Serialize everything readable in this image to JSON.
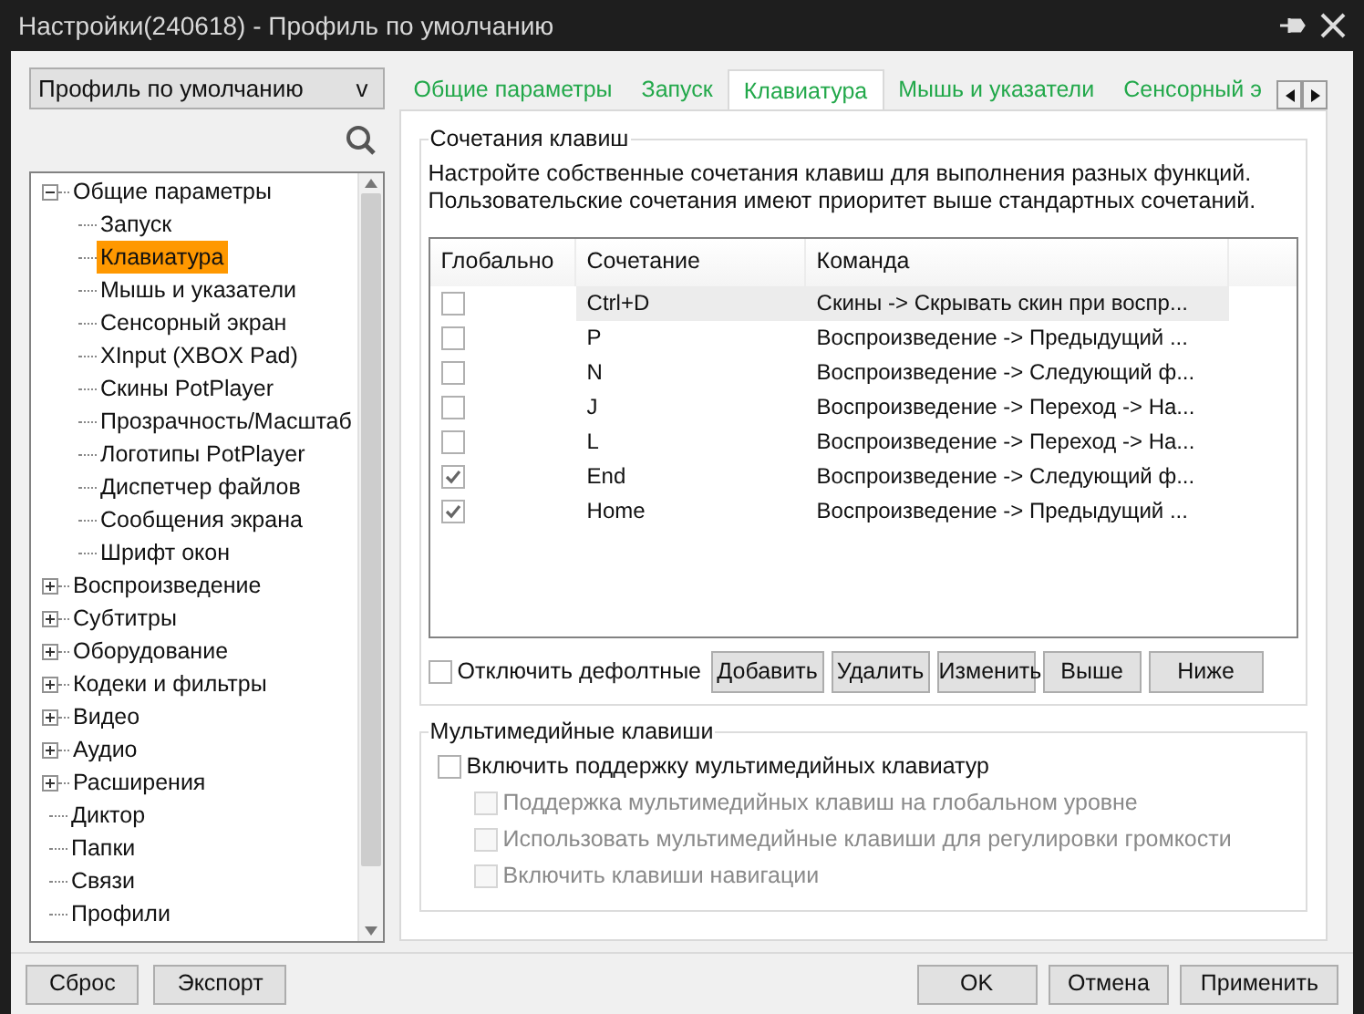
{
  "window": {
    "title": "Настройки(240618) - Профиль по умолчанию"
  },
  "profile": {
    "value": "Профиль по умолчанию",
    "arrow": "v"
  },
  "tree": [
    {
      "label": "Общие параметры",
      "expanded": true,
      "selected": false,
      "children": [
        {
          "label": "Запуск",
          "selected": false
        },
        {
          "label": "Клавиатура",
          "selected": true
        },
        {
          "label": "Мышь и указатели",
          "selected": false
        },
        {
          "label": "Сенсорный экран",
          "selected": false
        },
        {
          "label": "XInput (XBOX Pad)",
          "selected": false
        },
        {
          "label": "Скины PotPlayer",
          "selected": false
        },
        {
          "label": "Прозрачность/Масштаб",
          "selected": false
        },
        {
          "label": "Логотипы PotPlayer",
          "selected": false
        },
        {
          "label": "Диспетчер файлов",
          "selected": false
        },
        {
          "label": "Сообщения экрана",
          "selected": false
        },
        {
          "label": "Шрифт окон",
          "selected": false
        }
      ]
    },
    {
      "label": "Воспроизведение",
      "expanded": false,
      "selected": false
    },
    {
      "label": "Субтитры",
      "expanded": false,
      "selected": false
    },
    {
      "label": "Оборудование",
      "expanded": false,
      "selected": false
    },
    {
      "label": "Кодеки и фильтры",
      "expanded": false,
      "selected": false
    },
    {
      "label": "Видео",
      "expanded": false,
      "selected": false
    },
    {
      "label": "Аудио",
      "expanded": false,
      "selected": false
    },
    {
      "label": "Расширения",
      "expanded": false,
      "selected": false
    },
    {
      "label": "Диктор",
      "selected": false
    },
    {
      "label": "Папки",
      "selected": false
    },
    {
      "label": "Связи",
      "selected": false
    },
    {
      "label": "Профили",
      "selected": false
    }
  ],
  "tabs": [
    {
      "label": "Общие параметры",
      "selected": false
    },
    {
      "label": "Запуск",
      "selected": false
    },
    {
      "label": "Клавиатура",
      "selected": true
    },
    {
      "label": "Мышь и указатели",
      "selected": false
    },
    {
      "label": "Сенсорный э",
      "selected": false
    }
  ],
  "shortcuts": {
    "title": "Сочетания клавиш",
    "description": "Настройте собственные сочетания клавиш для выполнения разных функций.\nПользовательские сочетания имеют приоритет выше стандартных сочетаний.",
    "columns": [
      "Глобально",
      "Сочетание",
      "Команда"
    ],
    "rows": [
      {
        "global": false,
        "keys": "Ctrl+D",
        "command": "Скины -> Скрывать скин при воспр...",
        "selected": true
      },
      {
        "global": false,
        "keys": "P",
        "command": "Воспроизведение -> Предыдущий ...",
        "selected": false
      },
      {
        "global": false,
        "keys": "N",
        "command": "Воспроизведение -> Следующий ф...",
        "selected": false
      },
      {
        "global": false,
        "keys": "J",
        "command": "Воспроизведение -> Переход -> На...",
        "selected": false
      },
      {
        "global": false,
        "keys": "L",
        "command": "Воспроизведение -> Переход -> На...",
        "selected": false
      },
      {
        "global": true,
        "keys": "End",
        "command": "Воспроизведение -> Следующий ф...",
        "selected": false
      },
      {
        "global": true,
        "keys": "Home",
        "command": "Воспроизведение -> Предыдущий ...",
        "selected": false
      }
    ],
    "disable_defaults": {
      "label": "Отключить дефолтные",
      "checked": false
    },
    "buttons": [
      "Добавить",
      "Удалить",
      "Изменить",
      "Выше",
      "Ниже"
    ]
  },
  "multimedia": {
    "title": "Мультимедийные клавиши",
    "options": [
      {
        "label": "Включить поддержку мультимедийных клавиатур",
        "checked": false,
        "disabled": false
      },
      {
        "label": "Поддержка мультимедийных клавиш на глобальном уровне",
        "checked": false,
        "disabled": true
      },
      {
        "label": "Использовать мультимедийные клавиши для регулировки громкости",
        "checked": false,
        "disabled": true
      },
      {
        "label": "Включить клавиши навигации",
        "checked": false,
        "disabled": true
      }
    ]
  },
  "footer": {
    "left_buttons": [
      "Сброс",
      "Экспорт"
    ],
    "right_buttons": [
      "OK",
      "Отмена",
      "Применить"
    ]
  }
}
